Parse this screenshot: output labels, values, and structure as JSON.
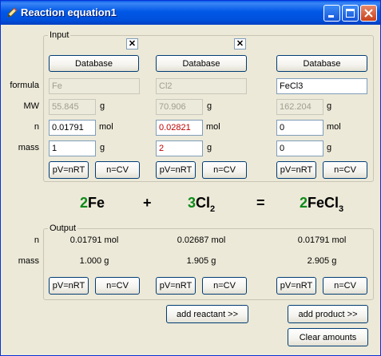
{
  "window": {
    "title": "Reaction equation1"
  },
  "input_group": {
    "label": "Input"
  },
  "output_group": {
    "label": "Output"
  },
  "row_labels": {
    "formula": "formula",
    "mw": "MW",
    "n": "n",
    "mass": "mass"
  },
  "units": {
    "g": "g",
    "mol": "mol"
  },
  "close_symbol": "✕",
  "columns": [
    {
      "database": "Database",
      "formula": "Fe",
      "mw": "55.845",
      "n": "0.01791",
      "mass": "1",
      "pv": "pV=nRT",
      "ncv": "n=CV",
      "out_n": "0.01791 mol",
      "out_mass": "1.000 g",
      "out_pv": "pV=nRT",
      "out_ncv": "n=CV"
    },
    {
      "database": "Database",
      "formula": "Cl2",
      "mw": "70.906",
      "n": "0.02821",
      "mass": "2",
      "pv": "pV=nRT",
      "ncv": "n=CV",
      "out_n": "0.02687 mol",
      "out_mass": "1.905 g",
      "out_pv": "pV=nRT",
      "out_ncv": "n=CV"
    },
    {
      "database": "Database",
      "formula": "FeCl3",
      "mw": "162.204",
      "n": "0",
      "mass": "0",
      "pv": "pV=nRT",
      "ncv": "n=CV",
      "out_n": "0.01791 mol",
      "out_mass": "2.905 g",
      "out_pv": "pV=nRT",
      "out_ncv": "n=CV"
    }
  ],
  "equation": {
    "terms": [
      {
        "coef": "2",
        "base": "Fe",
        "sub": ""
      },
      {
        "coef": "3",
        "base": "Cl",
        "sub": "2"
      },
      {
        "coef": "2",
        "base": "FeCl",
        "sub": "3"
      }
    ],
    "plus": "+",
    "equals": "="
  },
  "actions": {
    "add_reactant": "add reactant >>",
    "add_product": "add product >>",
    "clear_amounts": "Clear amounts"
  },
  "colors": {
    "coefficient": "#0d8a1a",
    "changed_value": "#c00000",
    "titlebar": "#0058e6"
  }
}
